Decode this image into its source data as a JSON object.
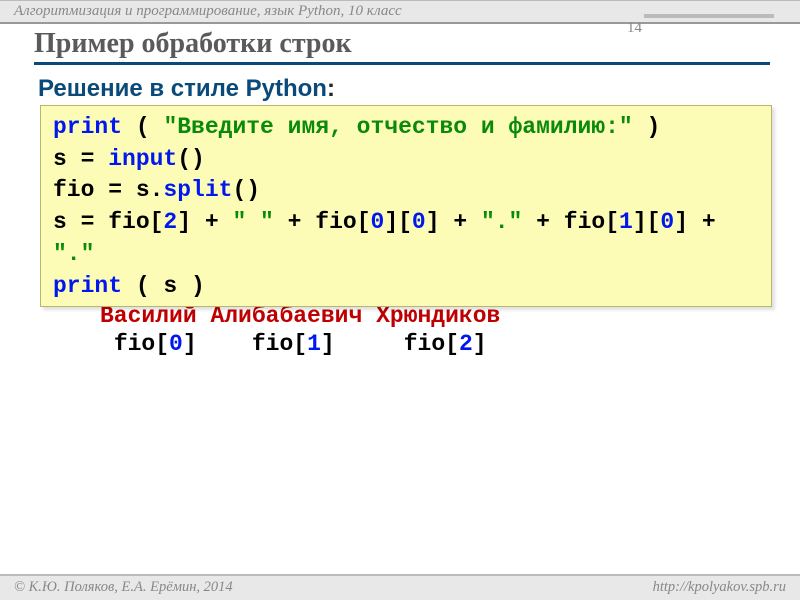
{
  "header": {
    "course": "Алгоритмизация и программирование, язык Python, 10 класс"
  },
  "page_number": "14",
  "title": "Пример обработки строк",
  "subhead": {
    "text": "Решение в стиле Python",
    "suffix": ":"
  },
  "code": {
    "print1_kw": "print",
    "print1_rest_a": " ( ",
    "print1_str": "\"Введите имя, отчество и фамилию:\"",
    "print1_rest_b": " )",
    "line2_a": "s = ",
    "input_kw": "input",
    "line2_b": "()",
    "line3_a": "fio = s.",
    "split_kw": "split",
    "line3_b": "()",
    "line4_a": "s = fio[",
    "n2": "2",
    "line4_b": "] + ",
    "space_str": "\" \"",
    "line4_c": " + fio[",
    "n0a": "0",
    "line4_d": "][",
    "n0b": "0",
    "line4_e": "] + ",
    "dot_str": "\".\"",
    "line4_f": " + fio[",
    "n1": "1",
    "line4_g": "][",
    "n0c": "0",
    "line4_h": "] +",
    "line5_str": " \".\"",
    "print2_kw": "print",
    "print2_rest": " ( s )"
  },
  "sample": {
    "w0": "Василий",
    "w1": "Алибабаевич",
    "w2": "Хрюндиков"
  },
  "idx": {
    "pre0": "fio[",
    "n0": "0",
    "post0": "]",
    "pre1": "fio[",
    "n1": "1",
    "post1": "]",
    "pre2": "fio[",
    "n2": "2",
    "post2": "]"
  },
  "footer": {
    "left": "© К.Ю. Поляков, Е.А. Ерёмин, 2014",
    "right": "http://kpolyakov.spb.ru"
  }
}
